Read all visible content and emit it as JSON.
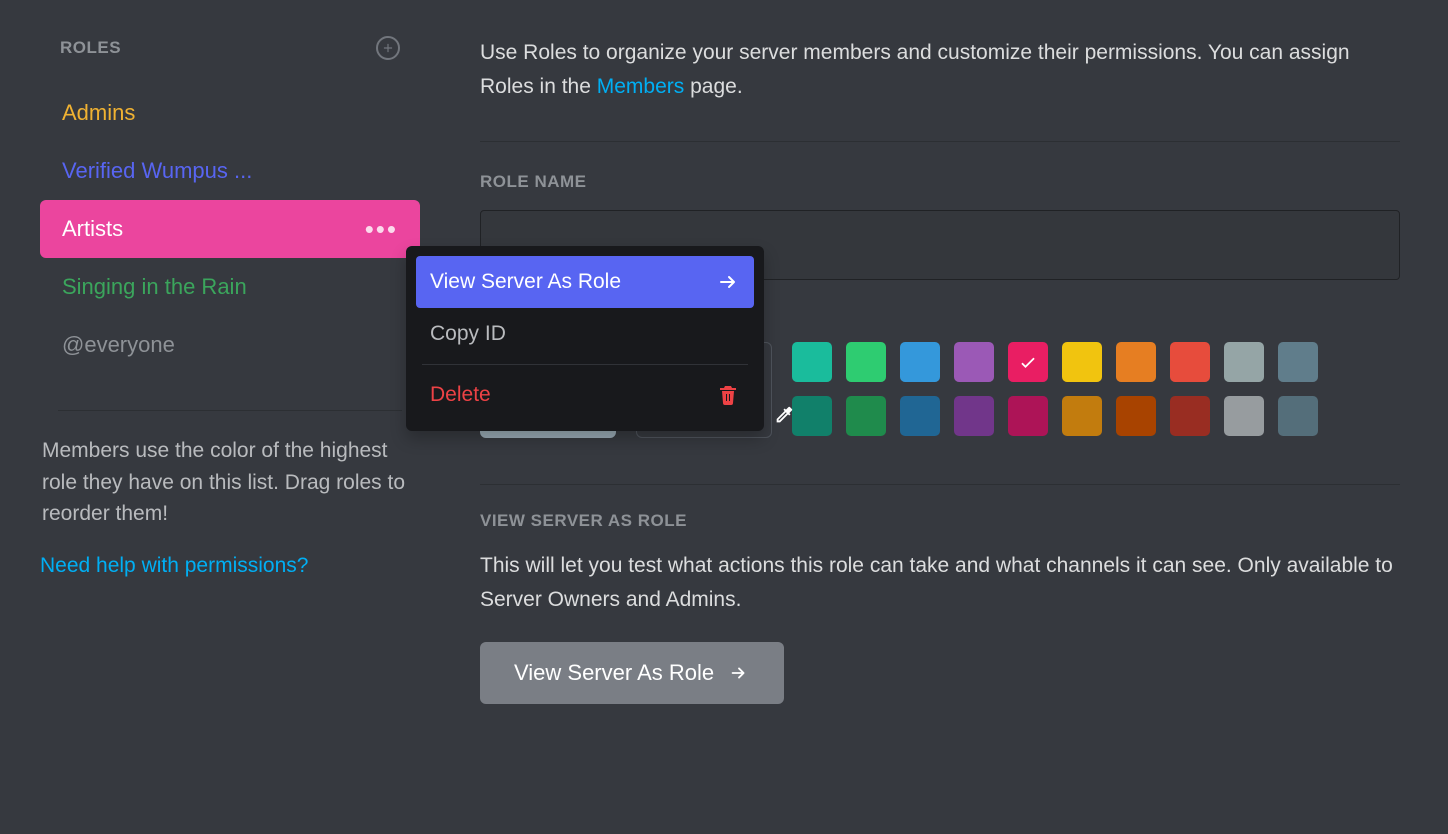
{
  "sidebar": {
    "title": "Roles",
    "roles": [
      {
        "label": "Admins",
        "color": "#f0b232"
      },
      {
        "label": "Verified Wumpus ...",
        "color": "#5865f2"
      },
      {
        "label": "Artists",
        "color": "#ffffff",
        "selected": true
      },
      {
        "label": "Singing in the Rain",
        "color": "#3ba55c"
      },
      {
        "label": "@everyone",
        "color": "#8e9297"
      }
    ],
    "hint": "Members use the color of the highest role they have on this list. Drag roles to reorder them!",
    "help_link": "Need help with permissions?"
  },
  "main": {
    "intro_pre": "Use Roles to organize your server members and customize their permissions. You can assign Roles in the ",
    "intro_link": "Members",
    "intro_post": " page.",
    "role_name_label": "Role Name",
    "role_name_value": "",
    "colors_row1": [
      "#1abc9c",
      "#2ecc71",
      "#3498db",
      "#9b59b6",
      "#e91e63",
      "#f1c40f",
      "#e67e22",
      "#e74c3c",
      "#95a5a6",
      "#607d8b"
    ],
    "colors_row2": [
      "#11806a",
      "#1f8b4c",
      "#206694",
      "#71368a",
      "#ad1457",
      "#c27c0e",
      "#a84300",
      "#992d22",
      "#979c9f",
      "#546e7a"
    ],
    "selected_color": "#e91e63",
    "view_as_role": {
      "heading": "View Server As Role",
      "desc": "This will let you test what actions this role can take and what channels it can see. Only available to Server Owners and Admins.",
      "button": "View Server As Role"
    }
  },
  "context_menu": {
    "view_as": "View Server As Role",
    "copy_id": "Copy ID",
    "delete": "Delete"
  }
}
